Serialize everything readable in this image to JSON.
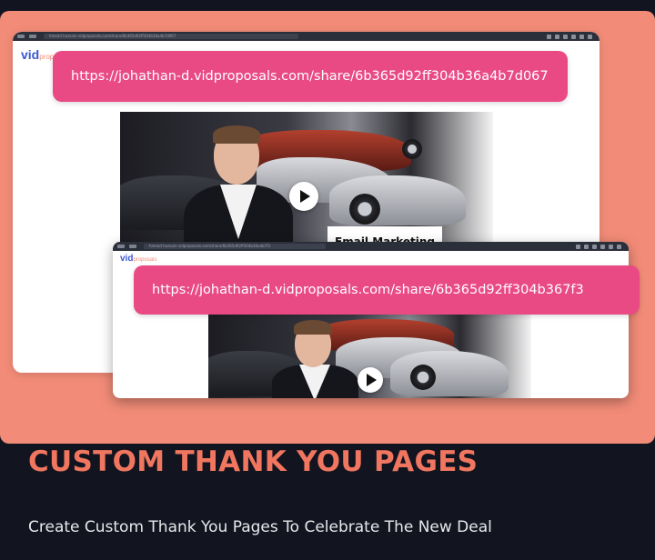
{
  "colors": {
    "page_bg": "#12141f",
    "panel_bg": "#f28c78",
    "url_pill": "#e94a84",
    "headline": "#f0765f",
    "logo_blue": "#3a56d4"
  },
  "window_back": {
    "address_bar": "hmead hussain vidproposals.com/share/6b365d92ff304b36a4b7d067",
    "logo_main": "vid",
    "logo_suffix": "propos",
    "share_url": "https://johathan-d.vidproposals.com/share/6b365d92ff304b36a4b7d067",
    "video_tag": "Email Marketing",
    "play_icon": "play-icon"
  },
  "window_front": {
    "address_bar": "hmead hussain vidproposals.com/share/6b365d92ff304b36a4b7f3",
    "logo_main": "vid",
    "logo_suffix": "proposals",
    "share_url": "https://johathan-d.vidproposals.com/share/6b365d92ff304b367f3",
    "play_icon": "play-icon"
  },
  "headline": "CUSTOM THANK YOU PAGES",
  "subline": "Create Custom Thank You Pages To Celebrate The New Deal"
}
